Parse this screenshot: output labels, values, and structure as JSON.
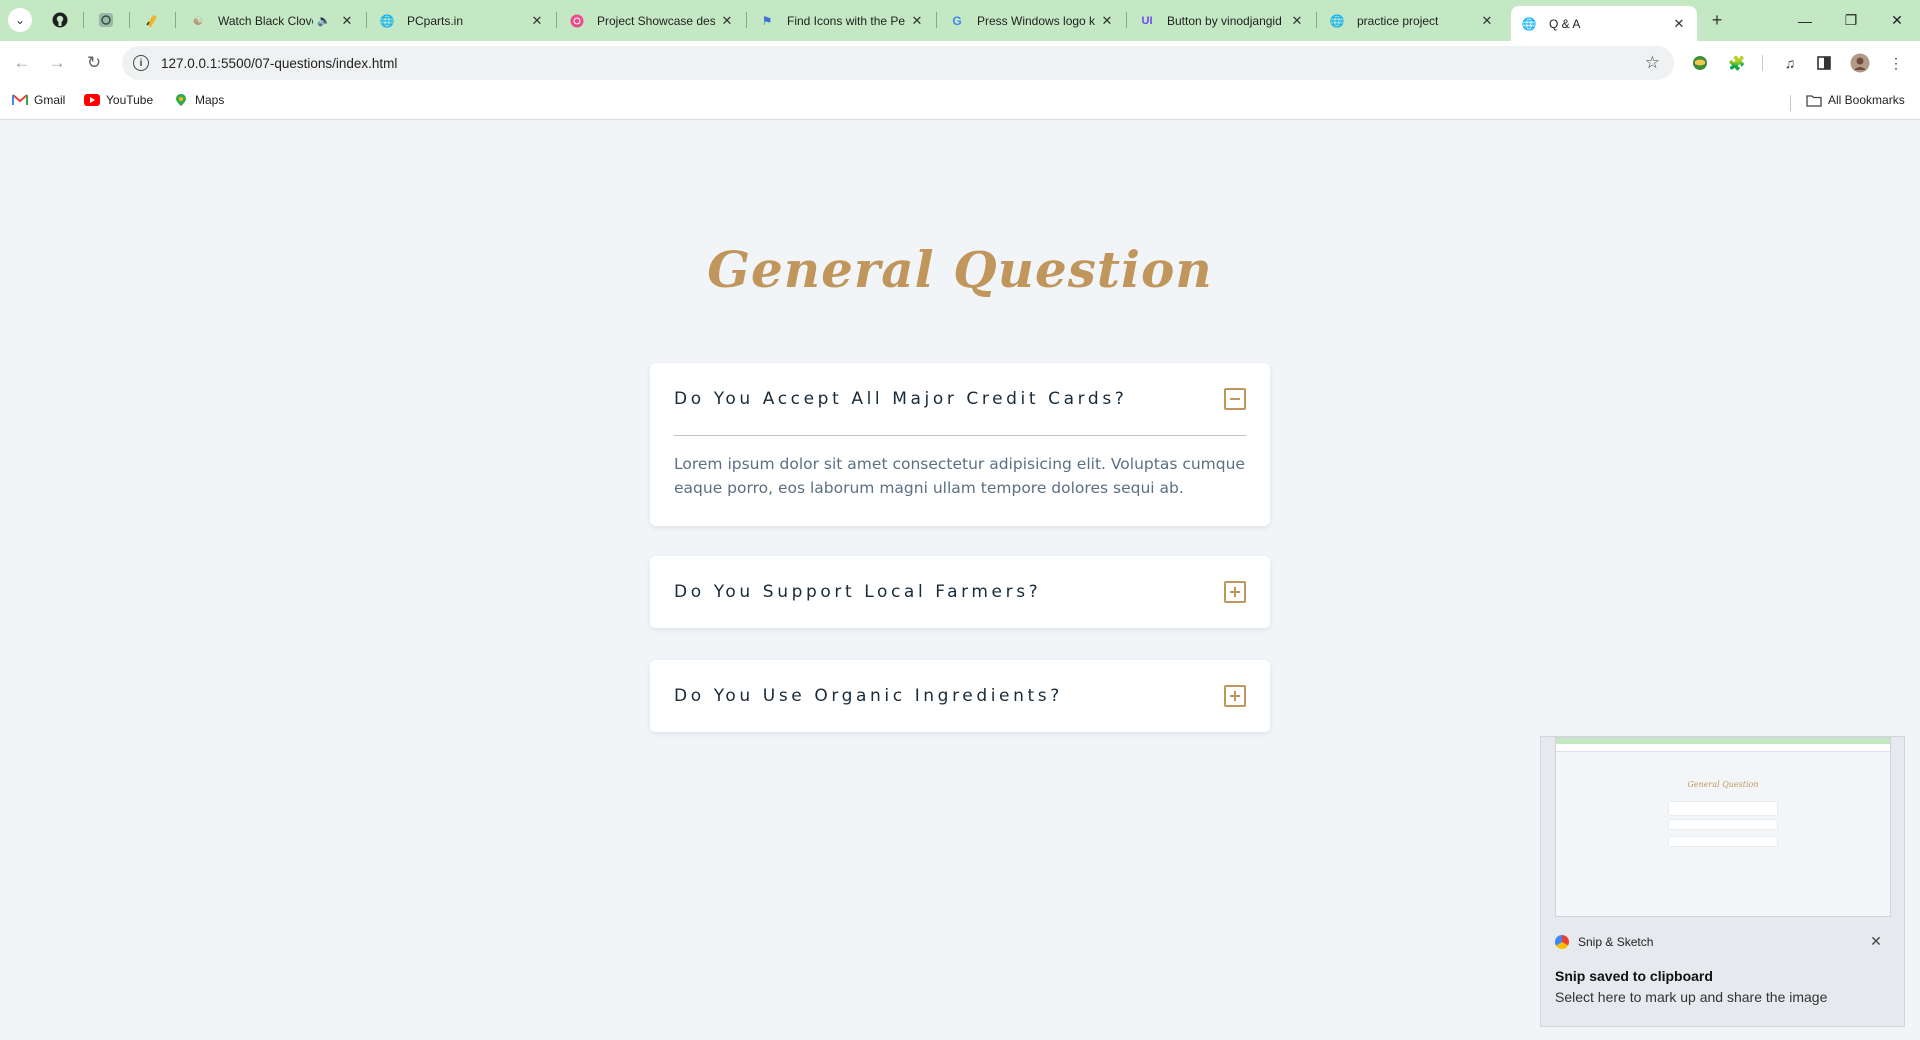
{
  "browser": {
    "tabs": [
      {
        "title": "Watch Black Clover",
        "icon": "anime-site-icon"
      },
      {
        "title": "PCparts.in",
        "icon": "globe-icon"
      },
      {
        "title": "Project Showcase design",
        "icon": "dribbble-icon"
      },
      {
        "title": "Find Icons with the Perfect",
        "icon": "flag-icon"
      },
      {
        "title": "Press Windows logo key",
        "icon": "google-icon"
      },
      {
        "title": "Button by vinodjangid",
        "icon": "uiverse-icon"
      },
      {
        "title": "practice project",
        "icon": "globe-icon"
      },
      {
        "title": "Q & A",
        "icon": "globe-icon",
        "active": true
      }
    ],
    "url": "127.0.0.1:5500/07-questions/index.html",
    "bookmarks": [
      {
        "label": "Gmail",
        "icon": "gmail-icon"
      },
      {
        "label": "YouTube",
        "icon": "youtube-icon"
      },
      {
        "label": "Maps",
        "icon": "maps-icon"
      }
    ],
    "all_bookmarks_label": "All Bookmarks"
  },
  "page": {
    "title": "General Question",
    "questions": [
      {
        "question": "Do You Accept All Major Credit Cards?",
        "expanded": true,
        "answer": "Lorem ipsum dolor sit amet consectetur adipisicing elit. Voluptas cumque eaque porro, eos laborum magni ullam tempore dolores sequi ab."
      },
      {
        "question": "Do You Support Local Farmers?",
        "expanded": false
      },
      {
        "question": "Do You Use Organic Ingredients?",
        "expanded": false
      }
    ]
  },
  "notification": {
    "app_name": "Snip & Sketch",
    "title": "Snip saved to clipboard",
    "body": "Select here to mark up and share the image"
  },
  "colors": {
    "accent": "#c1965d",
    "page_bg": "#f1f5f8",
    "tab_strip": "#c4e8c4",
    "question_text": "#182b3a",
    "answer_text": "#5b7085"
  }
}
